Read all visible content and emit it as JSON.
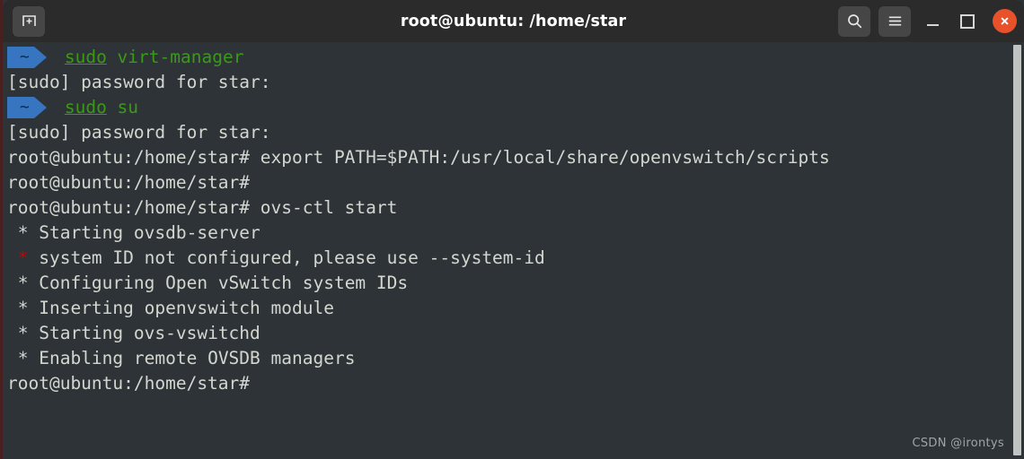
{
  "window": {
    "title": "root@ubuntu: /home/star",
    "colors": {
      "titlebar_bg": "#2b2b2b",
      "terminal_bg": "#2e3338",
      "close_button": "#e8512a",
      "prompt_blue": "#3775c0",
      "command_green": "#3a9a16",
      "error_red": "#cc0000",
      "text_gray": "#d3d7cf"
    }
  },
  "titlebar": {
    "new_tab_label": "new-tab",
    "search_label": "search",
    "menu_label": "menu",
    "minimize_label": "minimize",
    "maximize_label": "maximize",
    "close_label": "close"
  },
  "terminal": {
    "prompt_symbol": "~",
    "root_prompt": "root@ubuntu:/home/star# ",
    "lines": [
      {
        "type": "powerline",
        "segment": "~",
        "parts": [
          {
            "text": "sudo",
            "style": "green-u"
          },
          {
            "text": " virt-manager",
            "style": "green"
          }
        ]
      },
      {
        "type": "text",
        "parts": [
          {
            "text": "[sudo] password for star:",
            "style": "plain"
          }
        ]
      },
      {
        "type": "powerline",
        "segment": "~",
        "parts": [
          {
            "text": "sudo",
            "style": "green-u"
          },
          {
            "text": " su",
            "style": "green"
          }
        ]
      },
      {
        "type": "text",
        "parts": [
          {
            "text": "[sudo] password for star:",
            "style": "plain"
          }
        ]
      },
      {
        "type": "text",
        "parts": [
          {
            "text": "root@ubuntu:/home/star# export PATH=$PATH:/usr/local/share/openvswitch/scripts",
            "style": "plain"
          }
        ]
      },
      {
        "type": "text",
        "parts": [
          {
            "text": "root@ubuntu:/home/star#",
            "style": "plain"
          }
        ]
      },
      {
        "type": "text",
        "parts": [
          {
            "text": "root@ubuntu:/home/star# ovs-ctl start",
            "style": "plain"
          }
        ]
      },
      {
        "type": "text",
        "parts": [
          {
            "text": " * ",
            "style": "plain"
          },
          {
            "text": "Starting ovsdb-server",
            "style": "plain"
          }
        ]
      },
      {
        "type": "text",
        "parts": [
          {
            "text": " * ",
            "style": "red"
          },
          {
            "text": "system ID not configured, please use --system-id",
            "style": "plain"
          }
        ]
      },
      {
        "type": "text",
        "parts": [
          {
            "text": " * ",
            "style": "plain"
          },
          {
            "text": "Configuring Open vSwitch system IDs",
            "style": "plain"
          }
        ]
      },
      {
        "type": "text",
        "parts": [
          {
            "text": " * ",
            "style": "plain"
          },
          {
            "text": "Inserting openvswitch module",
            "style": "plain"
          }
        ]
      },
      {
        "type": "text",
        "parts": [
          {
            "text": " * ",
            "style": "plain"
          },
          {
            "text": "Starting ovs-vswitchd",
            "style": "plain"
          }
        ]
      },
      {
        "type": "text",
        "parts": [
          {
            "text": " * ",
            "style": "plain"
          },
          {
            "text": "Enabling remote OVSDB managers",
            "style": "plain"
          }
        ]
      },
      {
        "type": "text",
        "parts": [
          {
            "text": "root@ubuntu:/home/star#",
            "style": "plain"
          }
        ]
      }
    ]
  },
  "watermark": {
    "text": "CSDN @irontys"
  }
}
